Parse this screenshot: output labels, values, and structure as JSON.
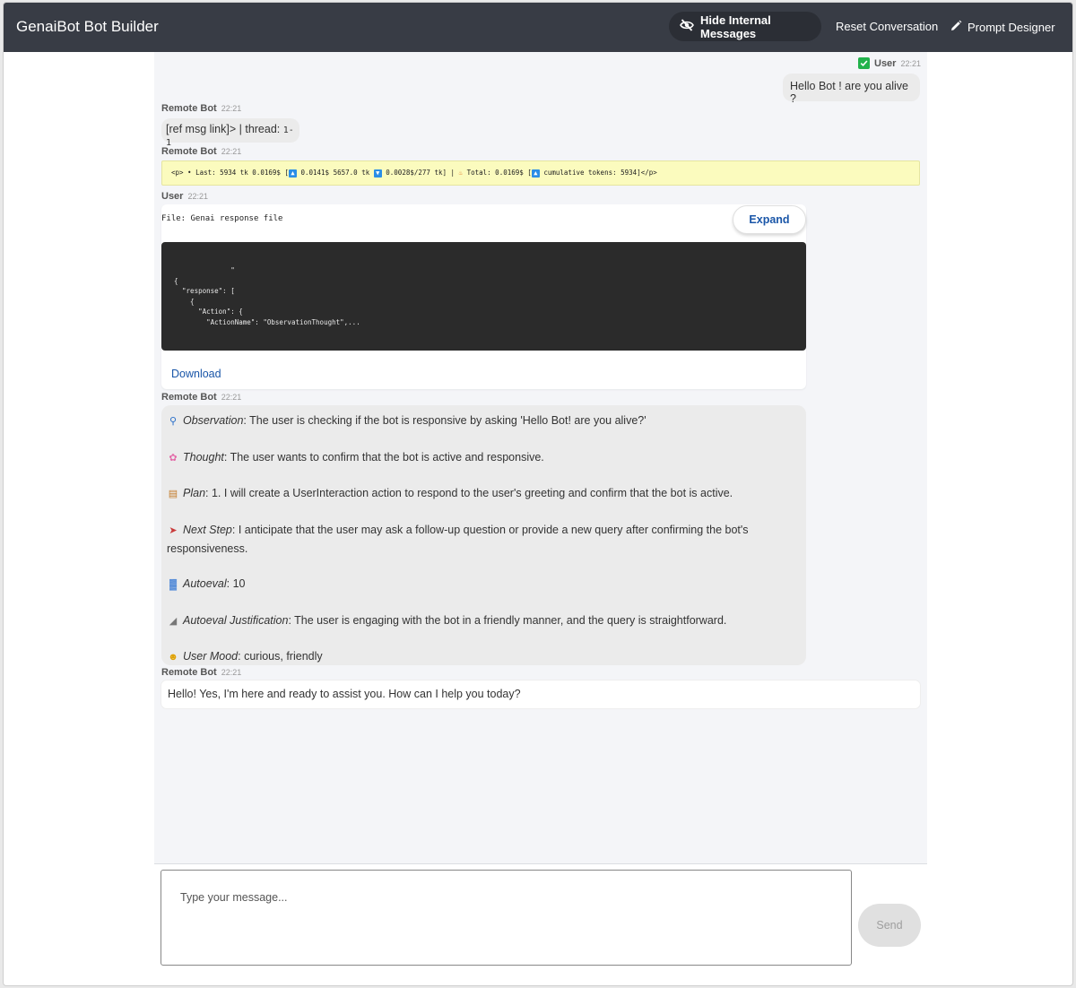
{
  "header": {
    "title": "GenaiBot Bot Builder",
    "hide_internal_label": "Hide Internal Messages",
    "reset_label": "Reset Conversation",
    "prompt_designer_label": "Prompt Designer"
  },
  "messages": [
    {
      "sender": "User",
      "time": "22:21",
      "text": "Hello Bot ! are you alive ?"
    },
    {
      "sender": "Remote Bot",
      "time": "22:21",
      "text": "[ref msg link]> | thread: ",
      "code": "1-1"
    },
    {
      "sender": "Remote Bot",
      "time": "22:21",
      "token_parts": [
        "<p> •  Last: 5934 tk 0.0169$ [",
        "0.0141$ 5657.0 tk",
        "0.0028$/277 tk] | ",
        "Total: 0.0169$ [",
        "cumulative tokens: 5934]</p>"
      ]
    },
    {
      "sender": "User",
      "time": "22:21",
      "file_label": "File: Genai response file",
      "expand_label": "Expand",
      "code_preview": "              \"\n{\n  \"response\": [\n    {\n      \"Action\": {\n        \"ActionName\": \"ObservationThought\",...",
      "download_label": "Download"
    },
    {
      "sender": "Remote Bot",
      "time": "22:21",
      "analysis": [
        {
          "icon": "magnifier",
          "label": "Observation",
          "text": ": The user is checking if the bot is responsive by asking 'Hello Bot! are you alive?'"
        },
        {
          "icon": "brain",
          "label": "Thought",
          "text": ": The user wants to confirm that the bot is active and responsive."
        },
        {
          "icon": "clipboard",
          "label": "Plan",
          "text": ": 1. I will create a UserInteraction action to respond to the user's greeting and confirm that the bot is active."
        },
        {
          "icon": "rocket",
          "label": "Next Step",
          "text": ": I anticipate that the user may ask a follow-up question or provide a new query after confirming the bot's responsiveness."
        },
        {
          "icon": "bar-chart",
          "label": "Autoeval",
          "text": ": 10"
        },
        {
          "icon": "triangle-ruler",
          "label": "Autoeval Justification",
          "text": ": The user is engaging with the bot in a friendly manner, and the query is straightforward."
        },
        {
          "icon": "smiling-face",
          "label": "User Mood",
          "text": ": curious, friendly"
        }
      ]
    },
    {
      "sender": "Remote Bot",
      "time": "22:21",
      "text": "Hello! Yes, I'm here and ready to assist you. How can I help you today?"
    }
  ],
  "composer": {
    "placeholder": "Type your message...",
    "send_label": "Send"
  },
  "colors": {
    "topbar": "#383c45",
    "chat_bg": "#f4f5f8",
    "token_bar": "#fbfbbe",
    "link": "#1a56a8",
    "check_green": "#22b24c"
  }
}
